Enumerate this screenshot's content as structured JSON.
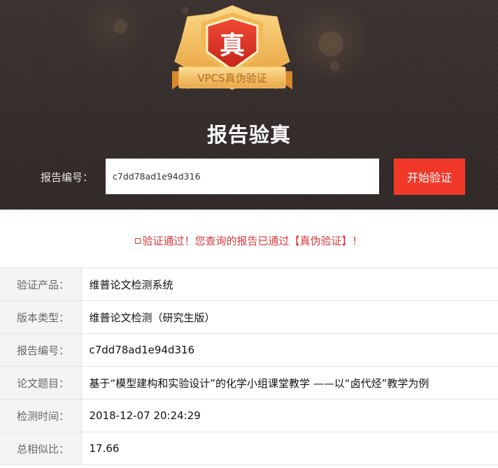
{
  "badge": {
    "char": "真",
    "ribbon_text": "VPCS真伪验证"
  },
  "hero": {
    "title": "报告验真"
  },
  "search": {
    "label": "报告编号：",
    "value": "c7dd78ad1e94d316",
    "button_label": "开始验证"
  },
  "result": {
    "message": "验证通过！您查询的报告已通过【真伪验证】！"
  },
  "details": [
    {
      "label": "验证产品：",
      "value": "维普论文检测系统"
    },
    {
      "label": "版本类型：",
      "value": "维普论文检测（研究生版）"
    },
    {
      "label": "报告编号：",
      "value": "c7dd78ad1e94d316"
    },
    {
      "label": "论文题目：",
      "value": "基于“模型建构和实验设计”的化学小组课堂教学 ——以“卤代烃”教学为例"
    },
    {
      "label": "检测时间：",
      "value": "2018-12-07 20:24:29"
    },
    {
      "label": "总相似比：",
      "value": "17.66"
    }
  ],
  "colors": {
    "accent_red": "#f1392a",
    "message_red": "#d8373b",
    "badge_gold": "#f6c25a"
  }
}
